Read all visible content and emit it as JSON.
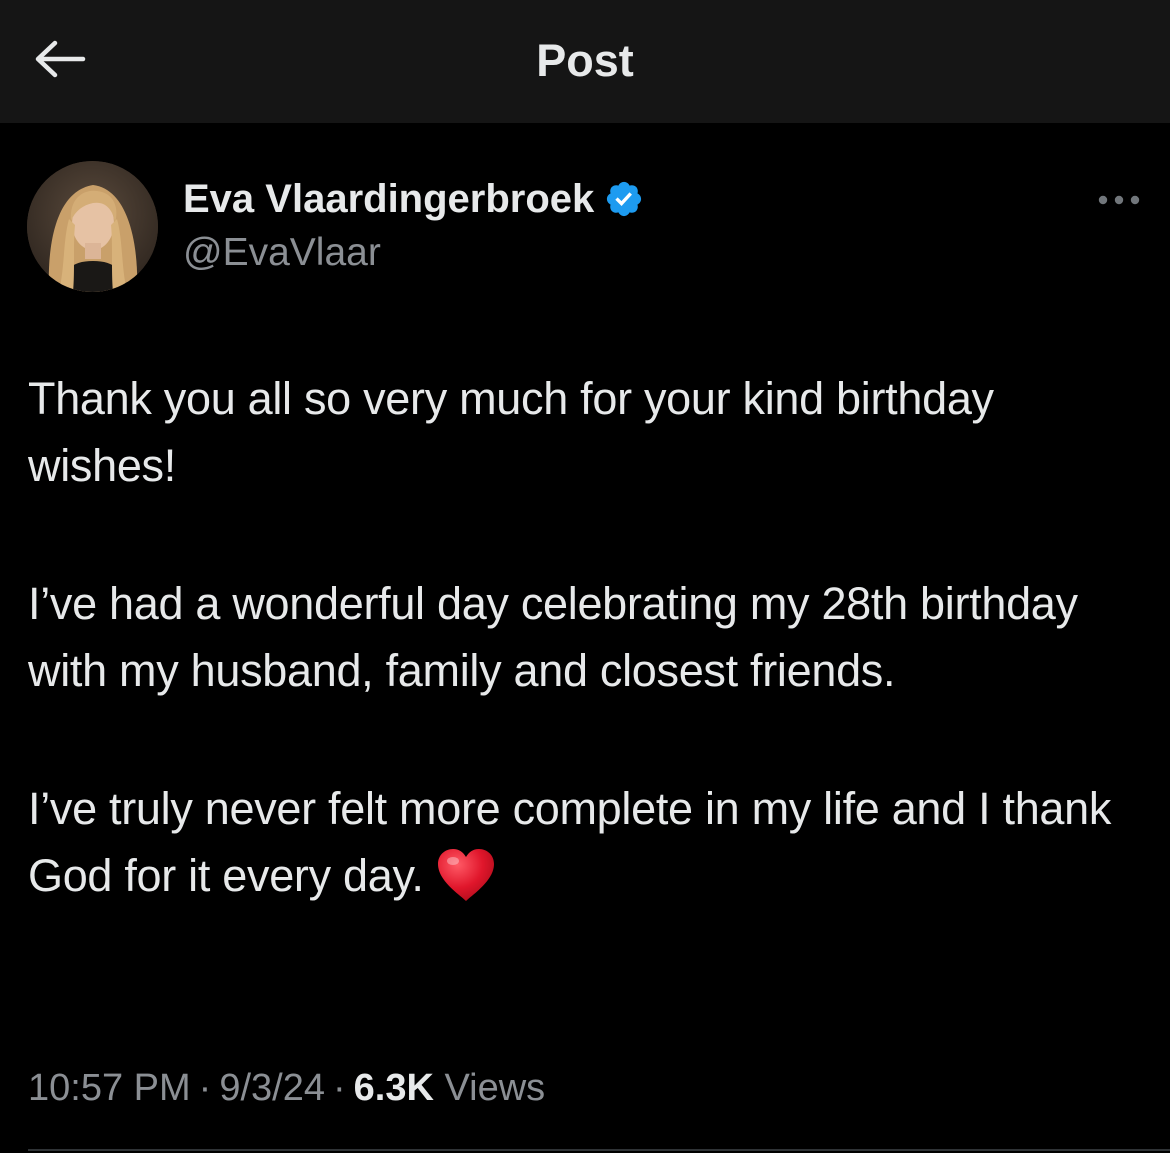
{
  "header": {
    "title": "Post",
    "back_icon": "arrow-left-icon"
  },
  "author": {
    "display_name": "Eva Vlaardingerbroek",
    "handle": "@EvaVlaar",
    "verified": true,
    "verified_color": "#1d9bf0",
    "avatar_icon": "avatar-photo"
  },
  "post": {
    "paragraphs": [
      "Thank you all so very much for your kind birthday wishes!",
      "I’ve had a wonderful day celebrating my 28th birthday with my husband, family and closest friends.",
      "I’ve truly never felt more complete in my life and I thank God for it every day."
    ],
    "emoji": "red-heart-icon"
  },
  "meta": {
    "time": "10:57 PM",
    "separator": "·",
    "date": "9/3/24",
    "views_count": "6.3K",
    "views_label": "Views"
  },
  "colors": {
    "background": "#000000",
    "topbar": "#151515",
    "text": "#e7e9ea",
    "secondary_text": "#8b8f94",
    "heart": "#e0162b"
  }
}
